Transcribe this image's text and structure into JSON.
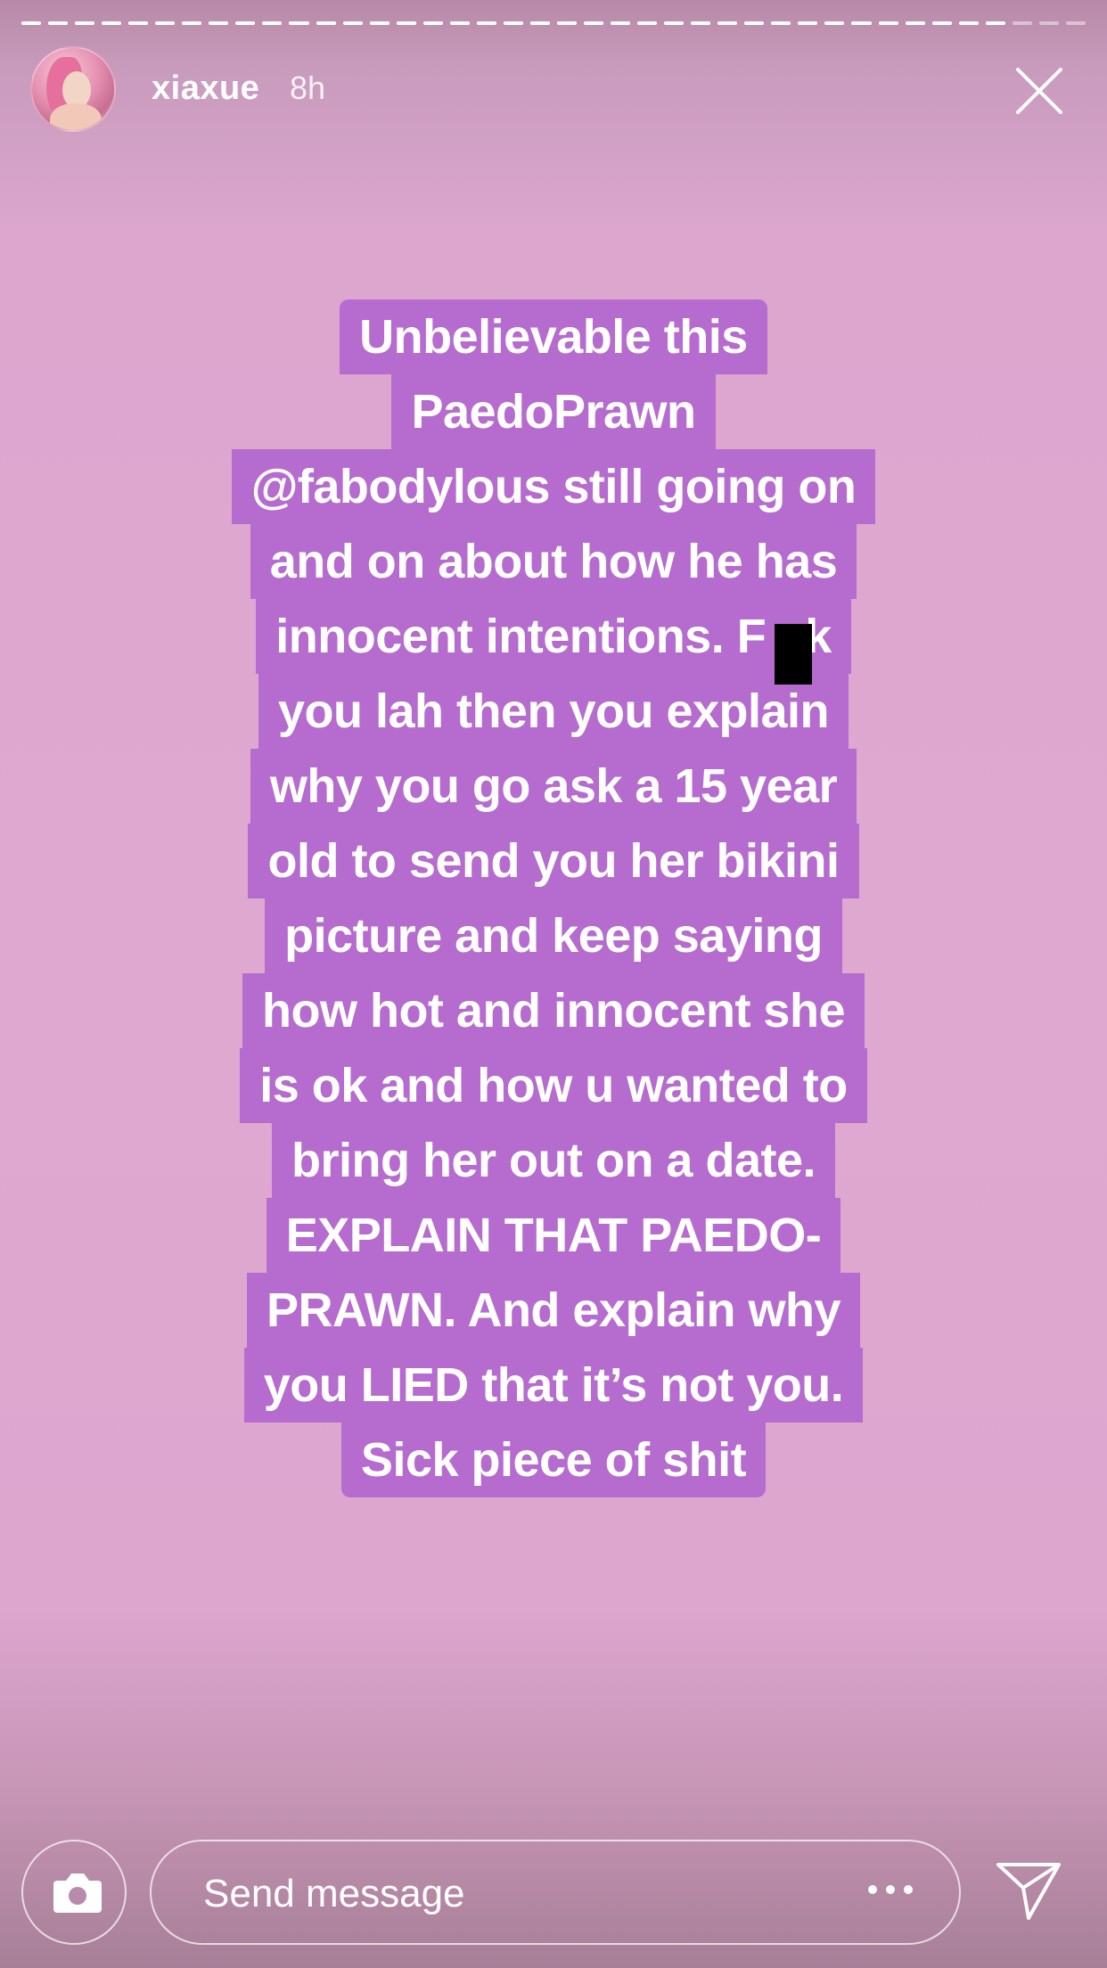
{
  "progress": {
    "segments": 40,
    "current_index": 37,
    "current_fill": 0.0
  },
  "header": {
    "username": "xiaxue",
    "time": "8h"
  },
  "icons": {
    "close": "close-icon",
    "camera": "camera-icon",
    "more": "more-dots-icon",
    "send": "send-icon"
  },
  "story": {
    "lines": [
      "Unbelievable this",
      "PaedoPrawn",
      "@fabodylous still going on",
      "and on about how he has",
      "innocent intentions. F  ck",
      "you lah then you explain",
      "why you go ask a 15 year",
      "old to send you her bikini",
      "picture and keep saying",
      "how hot and innocent she",
      "is ok and how u wanted to",
      "bring her out on a date.",
      "EXPLAIN THAT PAEDO-",
      "PRAWN. And explain why",
      "you LIED that it’s not you.",
      "Sick piece of shit"
    ]
  },
  "message": {
    "placeholder": "Send message"
  },
  "colors": {
    "text_bg": "#b66bcf",
    "background": "#dea8d1"
  }
}
